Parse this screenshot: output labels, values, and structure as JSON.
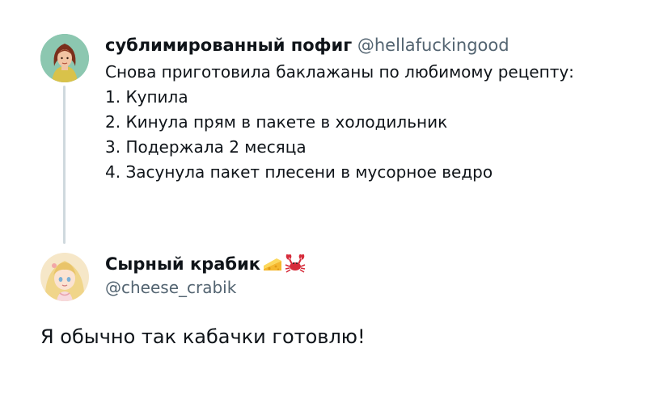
{
  "tweet1": {
    "display_name": "сублимированный пофиг",
    "handle": "@hellafuckingood",
    "lines": [
      "Снова приготовила баклажаны по любимому рецепту:",
      "1. Купила",
      "2. Кинула прям в пакете в холодильник",
      "3. Подержала 2 месяца",
      "4. Засунула пакет плесени в мусорное ведро"
    ]
  },
  "tweet2": {
    "display_name": "Сырный крабик",
    "emojis": [
      "cheese-icon",
      "crab-icon"
    ],
    "handle": "@cheese_crabik",
    "text": "Я обычно так кабачки готовлю!"
  },
  "colors": {
    "text": "#0f1419",
    "secondary": "#536471",
    "thread_line": "#cfd9de"
  }
}
